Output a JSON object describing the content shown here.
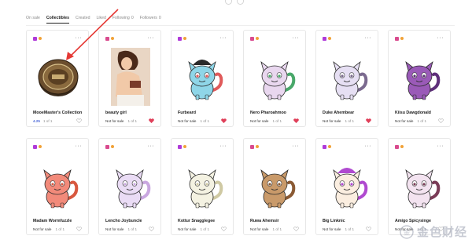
{
  "tabs": [
    {
      "label": "On sale",
      "count": ""
    },
    {
      "label": "Collectibles",
      "count": ""
    },
    {
      "label": "Created",
      "count": ""
    },
    {
      "label": "Liked",
      "count": ""
    },
    {
      "label": "Following",
      "count": "0"
    },
    {
      "label": "Followers",
      "count": "0"
    }
  ],
  "cards": [
    {
      "title": "MooeMaster's Collection",
      "price": "4.25",
      "status": "",
      "edition": "1 of 1",
      "liked": false,
      "kind": "coin"
    },
    {
      "title": "beauty girl",
      "price": "",
      "status": "Not for sale",
      "edition": "1 of 1",
      "liked": true,
      "kind": "photo"
    },
    {
      "title": "Furbeard",
      "price": "",
      "status": "Not for sale",
      "edition": "1 of 1",
      "liked": true,
      "kind": "cat",
      "body": "#8fd6e8",
      "accent": "#e05a5a",
      "hat": "#2b2b2b"
    },
    {
      "title": "Nero Pharoahmoo",
      "price": "",
      "status": "Not for sale",
      "edition": "1 of 1",
      "liked": true,
      "kind": "cat",
      "body": "#e9d7ef",
      "accent": "#49a86a",
      "hat": ""
    },
    {
      "title": "Duke Ahembear",
      "price": "",
      "status": "Not for sale",
      "edition": "1 of 1",
      "liked": true,
      "kind": "cat",
      "body": "#e6dff3",
      "accent": "#7b6a8f",
      "hat": ""
    },
    {
      "title": "Kiisu Dawgdonald",
      "price": "",
      "status": "Not for sale",
      "edition": "1 of 1",
      "liked": false,
      "kind": "cat",
      "body": "#9a5ab8",
      "accent": "#5e2f7a",
      "hat": ""
    },
    {
      "title": "Madam Wormfuzzle",
      "price": "",
      "status": "Not for sale",
      "edition": "1 of 1",
      "liked": false,
      "kind": "cat",
      "body": "#f28a7a",
      "accent": "#d8583f",
      "hat": ""
    },
    {
      "title": "Lencho Joybuncle",
      "price": "",
      "status": "Not for sale",
      "edition": "1 of 1",
      "liked": false,
      "kind": "cat",
      "body": "#eadcf5",
      "accent": "#c9a7e0",
      "hat": ""
    },
    {
      "title": "Kottur Snagglegee",
      "price": "",
      "status": "Not for sale",
      "edition": "1 of 1",
      "liked": false,
      "kind": "cat",
      "body": "#f4f2e2",
      "accent": "#cfc9a3",
      "hat": ""
    },
    {
      "title": "Ruwa Ahemsir",
      "price": "",
      "status": "Not for sale",
      "edition": "1 of 1",
      "liked": false,
      "kind": "cat",
      "body": "#c99a6a",
      "accent": "#8a5a34",
      "hat": ""
    },
    {
      "title": "Big Linknic",
      "price": "",
      "status": "Not for sale",
      "edition": "1 of 1",
      "liked": false,
      "kind": "cat",
      "body": "#fbeee0",
      "accent": "#b04ad0",
      "hat": "#b04ad0"
    },
    {
      "title": "Amigo Spicysinge",
      "price": "",
      "status": "Not for sale",
      "edition": "1 of 1",
      "liked": false,
      "kind": "cat",
      "body": "#f3e3f0",
      "accent": "#7a3b56",
      "hat": ""
    }
  ],
  "watermark": "金色财经",
  "colors": {
    "accent": "#4f6bd8",
    "liked": "#e0405a",
    "arrow": "#e53935"
  }
}
